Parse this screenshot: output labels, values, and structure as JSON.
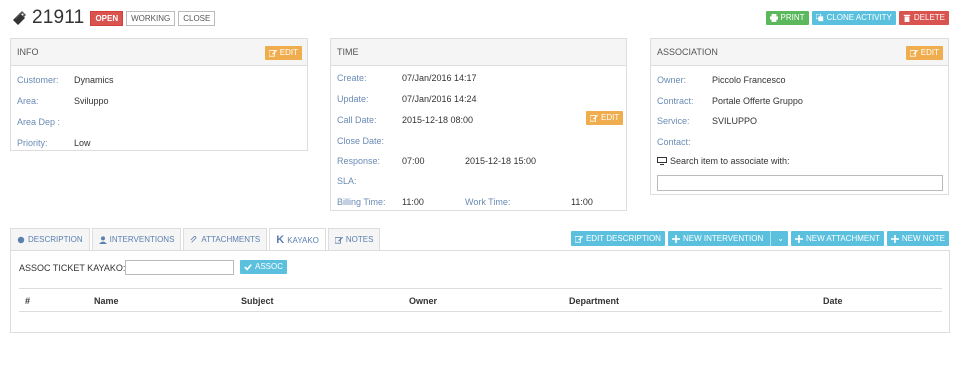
{
  "header": {
    "ticket_number": "21911",
    "statuses": [
      "OPEN",
      "WORKING",
      "CLOSE"
    ]
  },
  "actions": {
    "print": "PRINT",
    "clone": "CLONE ACTIVITY",
    "delete": "DELETE"
  },
  "info": {
    "title": "INFO",
    "edit": "EDIT",
    "customer_label": "Customer:",
    "customer": "Dynamics",
    "area_label": "Area:",
    "area": "Sviluppo",
    "area_dep_label": "Area Dep :",
    "area_dep": "",
    "priority_label": "Priority:",
    "priority": "Low"
  },
  "time": {
    "title": "TIME",
    "edit": "EDIT",
    "create_label": "Create:",
    "create": "07/Jan/2016 14:17",
    "update_label": "Update:",
    "update": "07/Jan/2016 14:24",
    "call_date_label": "Call Date:",
    "call_date": "2015-12-18 08:00",
    "close_date_label": "Close Date:",
    "close_date": "",
    "response_label": "Response:",
    "response": "07:00",
    "response_date": "2015-12-18 15:00",
    "sla_label": "SLA:",
    "sla": "",
    "billing_label": "Billing Time:",
    "billing": "11:00",
    "work_label": "Work Time:",
    "work": "11:00"
  },
  "association": {
    "title": "ASSOCIATION",
    "edit": "EDIT",
    "owner_label": "Owner:",
    "owner": "Piccolo Francesco",
    "contract_label": "Contract:",
    "contract": "Portale Offerte Gruppo",
    "service_label": "Service:",
    "service": "SVILUPPO",
    "contact_label": "Contact:",
    "contact": "",
    "search_label": "Search item to associate with:",
    "search_value": ""
  },
  "tabs": {
    "description": "DESCRIPTION",
    "interventions": "INTERVENTIONS",
    "attachments": "ATTACHMENTS",
    "kayako": "KAYAKO",
    "notes": "NOTES"
  },
  "tab_actions": {
    "edit_description": "EDIT DESCRIPTION",
    "new_intervention": "NEW INTERVENTION",
    "new_attachment": "NEW ATTACHMENT",
    "new_note": "NEW NOTE"
  },
  "kayako": {
    "assoc_label": "ASSOC TICKET KAYAKO:",
    "assoc_value": "",
    "assoc_button": "ASSOC",
    "columns": [
      "#",
      "Name",
      "Subject",
      "Owner",
      "Department",
      "Date"
    ]
  },
  "colors": {
    "danger": "#d9534f",
    "success": "#5cb85c",
    "info": "#5bc0de",
    "warning": "#f0ad4e",
    "label": "#6a8bb4"
  }
}
